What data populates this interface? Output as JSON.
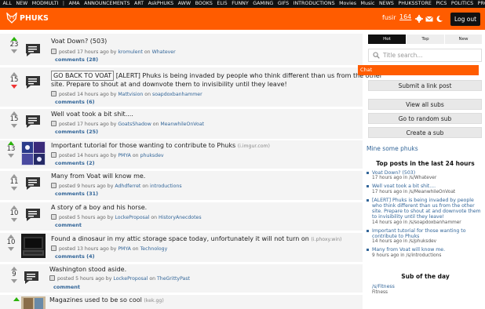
{
  "nav": {
    "items": [
      "ALL",
      "NEW",
      "MODMULTI",
      "|",
      "AMA",
      "ANNOUNCEMENTS",
      "ART",
      "AskPHUKS",
      "AWW",
      "BOOKS",
      "ELI5",
      "FUNNY",
      "GAMING",
      "GIFS",
      "INTRODUCTIONS",
      "Movies",
      "Music",
      "NEWS",
      "PHUKSSTORE",
      "PICS",
      "POLITICS",
      "PROGRAMMING"
    ]
  },
  "header": {
    "logo": "PHUKS",
    "username": "fusir",
    "karma": "164",
    "logout": "Log out"
  },
  "posts": [
    {
      "score": "23",
      "title": "Voat Down? (503)",
      "domain": "",
      "meta_pre": "posted 17 hours ago by",
      "author": "kromulent",
      "meta_on": "on",
      "sub": "Whatever",
      "comments": "comments (28)"
    },
    {
      "score": "15",
      "tag": "GO BACK TO VOAT",
      "title": "[ALERT] Phuks is being invaded by people who think different than us from the other",
      "title2": "site. Prepare to shout at and downvote them to invisibility until they leave!",
      "meta_pre": "posted 14 hours ago by",
      "author": "Mattvision",
      "meta_on": "on",
      "sub": "soapdoxbanhammer",
      "comments": "comments (6)"
    },
    {
      "score": "15",
      "title": "Well voat took a bit shit....",
      "meta_pre": "posted 17 hours ago by",
      "author": "GoatsShadow",
      "meta_on": "on",
      "sub": "MeanwhileOnVoat",
      "comments": "comments (25)"
    },
    {
      "score": "13",
      "title": "Important tutorial for those wanting to contribute to Phuks",
      "domain": "(i.imgur.com)",
      "meta_pre": "posted 14 hours ago by",
      "author": "PMYA",
      "meta_on": "on",
      "sub": "phuksdev",
      "comments": "comments (2)"
    },
    {
      "score": "11",
      "title": "Many from Voat will know me.",
      "meta_pre": "posted 9 hours ago by",
      "author": "Adhdferret",
      "meta_on": "on",
      "sub": "introductions",
      "comments": "comments (31)"
    },
    {
      "score": "10",
      "title": "A story of a boy and his horse.",
      "meta_pre": "posted 5 hours ago by",
      "author": "LockeProposal",
      "meta_on": "on",
      "sub": "HistoryAnecdotes",
      "comments": "comment"
    },
    {
      "score": "10",
      "title": "Found a dinosaur in my attic storage space today, unfortunately it will not turn on",
      "domain": "(i.phoxy.win)",
      "meta_pre": "posted 13 hours ago by",
      "author": "PMYA",
      "meta_on": "on",
      "sub": "Technology",
      "comments": "comments (4)"
    },
    {
      "score": "9",
      "title": "Washington stood aside.",
      "meta_pre": "posted 5 hours ago by",
      "author": "LockeProposal",
      "meta_on": "on",
      "sub": "TheGrittyPast",
      "comments": "comment"
    },
    {
      "score": "",
      "title": "Magazines used to be so cool",
      "domain": "(kek.gg)"
    }
  ],
  "sidebar": {
    "tabs": [
      "Hot",
      "Top",
      "New"
    ],
    "search_placeholder": "Title search...",
    "chat": "Chat",
    "submit_link": "Submit a link post",
    "view_all": "View all subs",
    "random": "Go to random sub",
    "create": "Create a sub",
    "mine": "Mine some phuks",
    "top_heading": "Top posts in the last 24 hours",
    "top_posts": [
      {
        "t": "Voat Down? (503)",
        "m": "17 hours ago in /s/Whatever"
      },
      {
        "t": "Well voat took a bit shit....",
        "m": "17 hours ago in /s/MeanwhileOnVoat"
      },
      {
        "t": "[ALERT] Phuks is being invaded by people who think different than us from the other site. Prepare to shout at and downvote them to invisibility until they leave!",
        "m": "14 hours ago in /s/soapdoxbanhammer"
      },
      {
        "t": "Important tutorial for those wanting to contribute to Phuks",
        "m": "14 hours ago in /s/phuksdev"
      },
      {
        "t": "Many from Voat will know me.",
        "m": "9 hours ago in /s/introductions"
      }
    ],
    "sub_heading": "Sub of the day",
    "sub_name": "/s/Fitness",
    "sub_desc": "Fitness"
  }
}
